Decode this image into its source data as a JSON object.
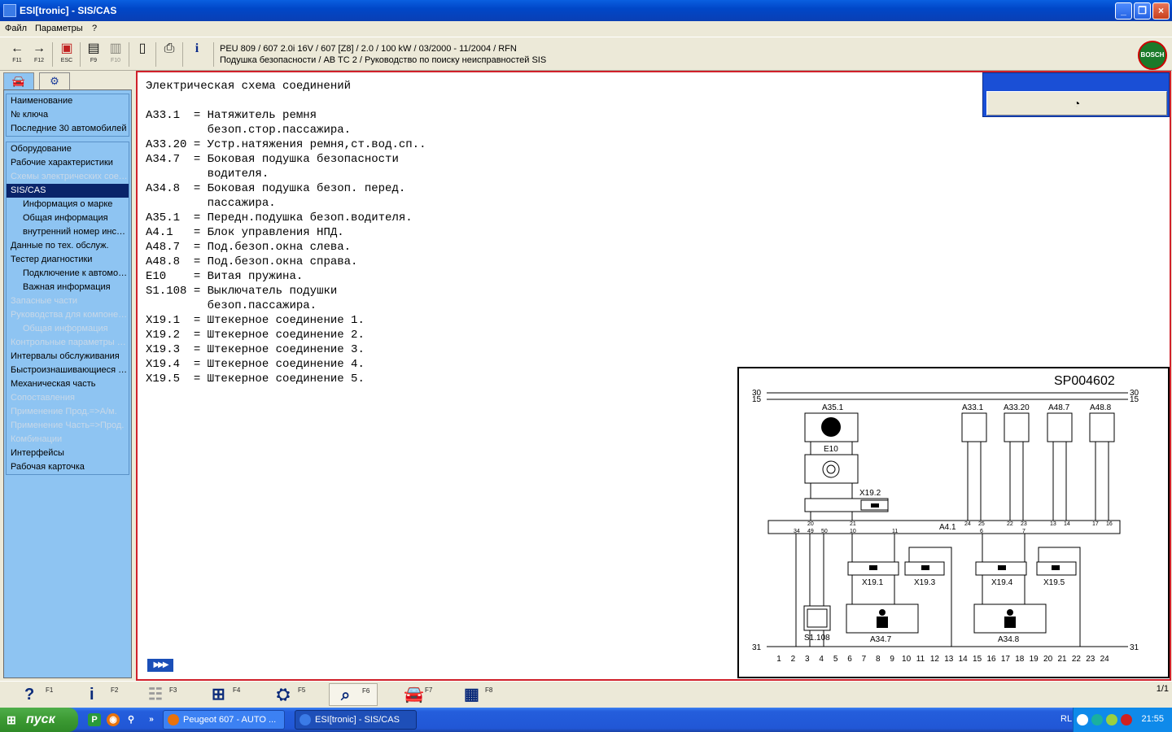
{
  "window": {
    "title": "ESI[tronic] - SIS/CAS"
  },
  "menu": [
    "Файл",
    "Параметры",
    "?"
  ],
  "toolbar": {
    "buttons": [
      {
        "icon": "arrow-left-icon",
        "glyph": "←",
        "key": "F11"
      },
      {
        "icon": "arrow-right-icon",
        "glyph": "→",
        "key": "F12"
      },
      {
        "icon": "escape-icon",
        "glyph": "▣",
        "key": "ESC"
      },
      {
        "icon": "list-icon",
        "glyph": "▤",
        "key": "F9"
      },
      {
        "icon": "split-icon",
        "glyph": "▥",
        "key": "F10"
      },
      {
        "icon": "document-icon",
        "glyph": "▯",
        "key": ""
      },
      {
        "icon": "printer-icon",
        "glyph": "⎙",
        "key": ""
      },
      {
        "icon": "info-icon",
        "glyph": "i",
        "key": ""
      }
    ],
    "vehicle_line": "PEU 809 / 607 2.0i 16V / 607 [Z8] / 2.0 / 100 kW / 03/2000 - 11/2004 / RFN",
    "path_line": "Подушка безопасности / AB TC 2 / Руководство по поиску неисправностей SIS",
    "logo_text": "BOSCH"
  },
  "left_tabs": [
    {
      "icon": "car-icon",
      "glyph": "🚘"
    },
    {
      "icon": "engine-icon",
      "glyph": "⚙"
    }
  ],
  "sidebar": {
    "group1": [
      {
        "label": "Наименование",
        "state": "normal"
      },
      {
        "label": "№ ключа",
        "state": "normal"
      },
      {
        "label": "Последние 30 автомобилей",
        "state": "normal"
      }
    ],
    "group2": [
      {
        "label": "Оборудование",
        "state": "normal",
        "sub": false
      },
      {
        "label": "Рабочие характеристики",
        "state": "normal",
        "sub": false
      },
      {
        "label": "Схемы электрических соединений",
        "state": "disabled",
        "sub": false
      },
      {
        "label": "SIS/CAS",
        "state": "selected",
        "sub": false
      },
      {
        "label": "Информация о марке",
        "state": "normal",
        "sub": true
      },
      {
        "label": "Общая информация",
        "state": "normal",
        "sub": true
      },
      {
        "label": "внутренний номер инструкции",
        "state": "normal",
        "sub": true
      },
      {
        "label": "Данные по тех. обслуж.",
        "state": "normal",
        "sub": false
      },
      {
        "label": "Тестер диагностики",
        "state": "normal",
        "sub": false
      },
      {
        "label": "Подключение к автомобилю",
        "state": "normal",
        "sub": true
      },
      {
        "label": "Важная информация",
        "state": "normal",
        "sub": true
      },
      {
        "label": "Запасные части",
        "state": "disabled",
        "sub": false
      },
      {
        "label": "Руководства для компонентов",
        "state": "disabled",
        "sub": false
      },
      {
        "label": "Общая информация",
        "state": "disabled",
        "sub": true
      },
      {
        "label": "Контрольные параметры двигателя",
        "state": "disabled",
        "sub": false
      },
      {
        "label": "Интервалы обслуживания",
        "state": "normal",
        "sub": false
      },
      {
        "label": "Быстроизнашивающиеся детали",
        "state": "normal",
        "sub": false
      },
      {
        "label": "Механическая часть",
        "state": "normal",
        "sub": false
      },
      {
        "label": "Сопоставления",
        "state": "disabled",
        "sub": false
      },
      {
        "label": "Применение Прод.=>А/м.",
        "state": "disabled",
        "sub": false
      },
      {
        "label": "Применение Часть=>Прод.",
        "state": "disabled",
        "sub": false
      },
      {
        "label": "Комбинации",
        "state": "disabled",
        "sub": false
      },
      {
        "label": "Интерфейсы",
        "state": "normal",
        "sub": false
      },
      {
        "label": "Рабочая карточка",
        "state": "normal",
        "sub": false
      }
    ]
  },
  "content": {
    "heading": "Электрическая схема соединений",
    "legend": [
      {
        "code": "A33.1",
        "desc": [
          "Натяжитель ремня",
          "безоп.стор.пассажира."
        ]
      },
      {
        "code": "A33.20",
        "desc": [
          "Устр.натяжения ремня,ст.вод.сп.."
        ]
      },
      {
        "code": "A34.7",
        "desc": [
          "Боковая подушка безопасности",
          "водителя."
        ]
      },
      {
        "code": "A34.8",
        "desc": [
          "Боковая подушка безоп. перед.",
          "пассажира."
        ]
      },
      {
        "code": "A35.1",
        "desc": [
          "Передн.подушка безоп.водителя."
        ]
      },
      {
        "code": "A4.1",
        "desc": [
          "Блок управления НПД."
        ]
      },
      {
        "code": "A48.7",
        "desc": [
          "Под.безоп.окна слева."
        ]
      },
      {
        "code": "A48.8",
        "desc": [
          "Под.безоп.окна справа."
        ]
      },
      {
        "code": "E10",
        "desc": [
          "Витая пружина."
        ]
      },
      {
        "code": "S1.108",
        "desc": [
          "Выключатель подушки",
          "безоп.пассажира."
        ]
      },
      {
        "code": "X19.1",
        "desc": [
          "Штекерное соединение 1."
        ]
      },
      {
        "code": "X19.2",
        "desc": [
          "Штекерное соединение 2."
        ]
      },
      {
        "code": "X19.3",
        "desc": [
          "Штекерное соединение 3."
        ]
      },
      {
        "code": "X19.4",
        "desc": [
          "Штекерное соединение 4."
        ]
      },
      {
        "code": "X19.5",
        "desc": [
          "Штекерное соединение 5."
        ]
      }
    ],
    "more_glyph": "▶▶▶",
    "meter_glyph": "◔"
  },
  "schematic": {
    "id": "SP004602",
    "rail_labels": {
      "top30": "30",
      "top15": "15",
      "bottom31": "31"
    },
    "components": {
      "A35.1": "A35.1",
      "E10": "E10",
      "X19.2": "X19.2",
      "A33.1": "A33.1",
      "A33.20": "A33.20",
      "A48.7": "A48.7",
      "A48.8": "A48.8",
      "A4.1": "A4.1",
      "X19.1": "X19.1",
      "X19.3": "X19.3",
      "X19.4": "X19.4",
      "X19.5": "X19.5",
      "S1.108": "S1.108",
      "A34.7": "A34.7",
      "A34.8": "A34.8"
    },
    "pins_top": [
      "20",
      "21",
      "24",
      "25",
      "22",
      "23",
      "13",
      "14",
      "17",
      "16"
    ],
    "pins_bottom": [
      "34",
      "49",
      "50",
      "10",
      "11",
      "6",
      "7"
    ],
    "columns": [
      "1",
      "2",
      "3",
      "4",
      "5",
      "6",
      "7",
      "8",
      "9",
      "10",
      "11",
      "12",
      "13",
      "14",
      "15",
      "16",
      "17",
      "18",
      "19",
      "20",
      "21",
      "22",
      "23",
      "24"
    ]
  },
  "bottombar": {
    "buttons": [
      {
        "icon": "help-icon",
        "glyph": "?",
        "key": "F1",
        "state": "normal"
      },
      {
        "icon": "info-icon",
        "glyph": "i",
        "key": "F2",
        "state": "normal"
      },
      {
        "icon": "list-view-icon",
        "glyph": "☷",
        "key": "F3",
        "state": "disabled"
      },
      {
        "icon": "circuit-icon",
        "glyph": "⊞",
        "key": "F4",
        "state": "normal"
      },
      {
        "icon": "component-icon",
        "glyph": "⛭",
        "key": "F5",
        "state": "normal"
      },
      {
        "icon": "zoom-icon",
        "glyph": "⌕",
        "key": "F6",
        "state": "active"
      },
      {
        "icon": "car-icon",
        "glyph": "🚘",
        "key": "F7",
        "state": "normal"
      },
      {
        "icon": "esi-kts-icon",
        "glyph": "▦",
        "key": "F8",
        "state": "normal"
      }
    ],
    "page": "1/1"
  },
  "taskbar": {
    "start_label": "пуск",
    "tasks": [
      {
        "label": "Peugeot 607 - AUTO ...",
        "active": false,
        "color": "#e8720c"
      },
      {
        "label": "ESI[tronic] - SIS/CAS",
        "active": true,
        "color": "#3b7be6"
      }
    ],
    "lang": "RL",
    "time": "21:55"
  }
}
